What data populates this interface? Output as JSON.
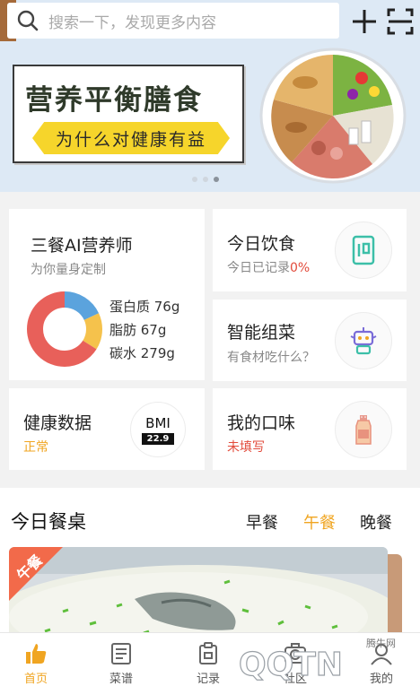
{
  "search": {
    "placeholder": "搜索一下，发现更多内容"
  },
  "icons": {
    "search": "search-icon",
    "add": "plus-icon",
    "scan": "scan-icon"
  },
  "banner": {
    "title": "营养平衡膳食",
    "subtitle": "为什么对健康有益",
    "page_count": 3,
    "active_page": 3
  },
  "ai_nutritionist": {
    "title": "三餐AI营养师",
    "subtitle": "为你量身定制",
    "nutrients": [
      {
        "label": "蛋白质 76g",
        "color": "#5ba3dd"
      },
      {
        "label": "脂肪 67g",
        "color": "#f5c24c"
      },
      {
        "label": "碳水 279g",
        "color": "#e8605a"
      }
    ],
    "donut_values": [
      76,
      67,
      279
    ]
  },
  "today_diet": {
    "title": "今日饮食",
    "status_prefix": "今日已记录",
    "status_value": "0%"
  },
  "smart_combo": {
    "title": "智能组菜",
    "subtitle": "有食材吃什么？"
  },
  "health_data": {
    "title": "健康数据",
    "status": "正常",
    "bmi_label": "BMI",
    "bmi_value": "22.9"
  },
  "my_taste": {
    "title": "我的口味",
    "status": "未填写"
  },
  "today_table": {
    "title": "今日餐桌",
    "tabs": [
      {
        "label": "早餐",
        "active": false
      },
      {
        "label": "午餐",
        "active": true
      },
      {
        "label": "晚餐",
        "active": false
      }
    ],
    "card_badge": "午餐"
  },
  "tabbar": [
    {
      "label": "首页",
      "icon": "home-like-icon",
      "active": true
    },
    {
      "label": "菜谱",
      "icon": "recipe-icon",
      "active": false
    },
    {
      "label": "记录",
      "icon": "record-icon",
      "active": false
    },
    {
      "label": "社区",
      "icon": "community-icon",
      "active": false
    },
    {
      "label": "我的",
      "icon": "profile-icon",
      "active": false
    }
  ],
  "watermark": {
    "text": "腾牛网",
    "logo": "QQTN"
  },
  "colors": {
    "accent": "#f0a521",
    "alert": "#e24b3b",
    "banner_bg": "#dde9f5"
  }
}
